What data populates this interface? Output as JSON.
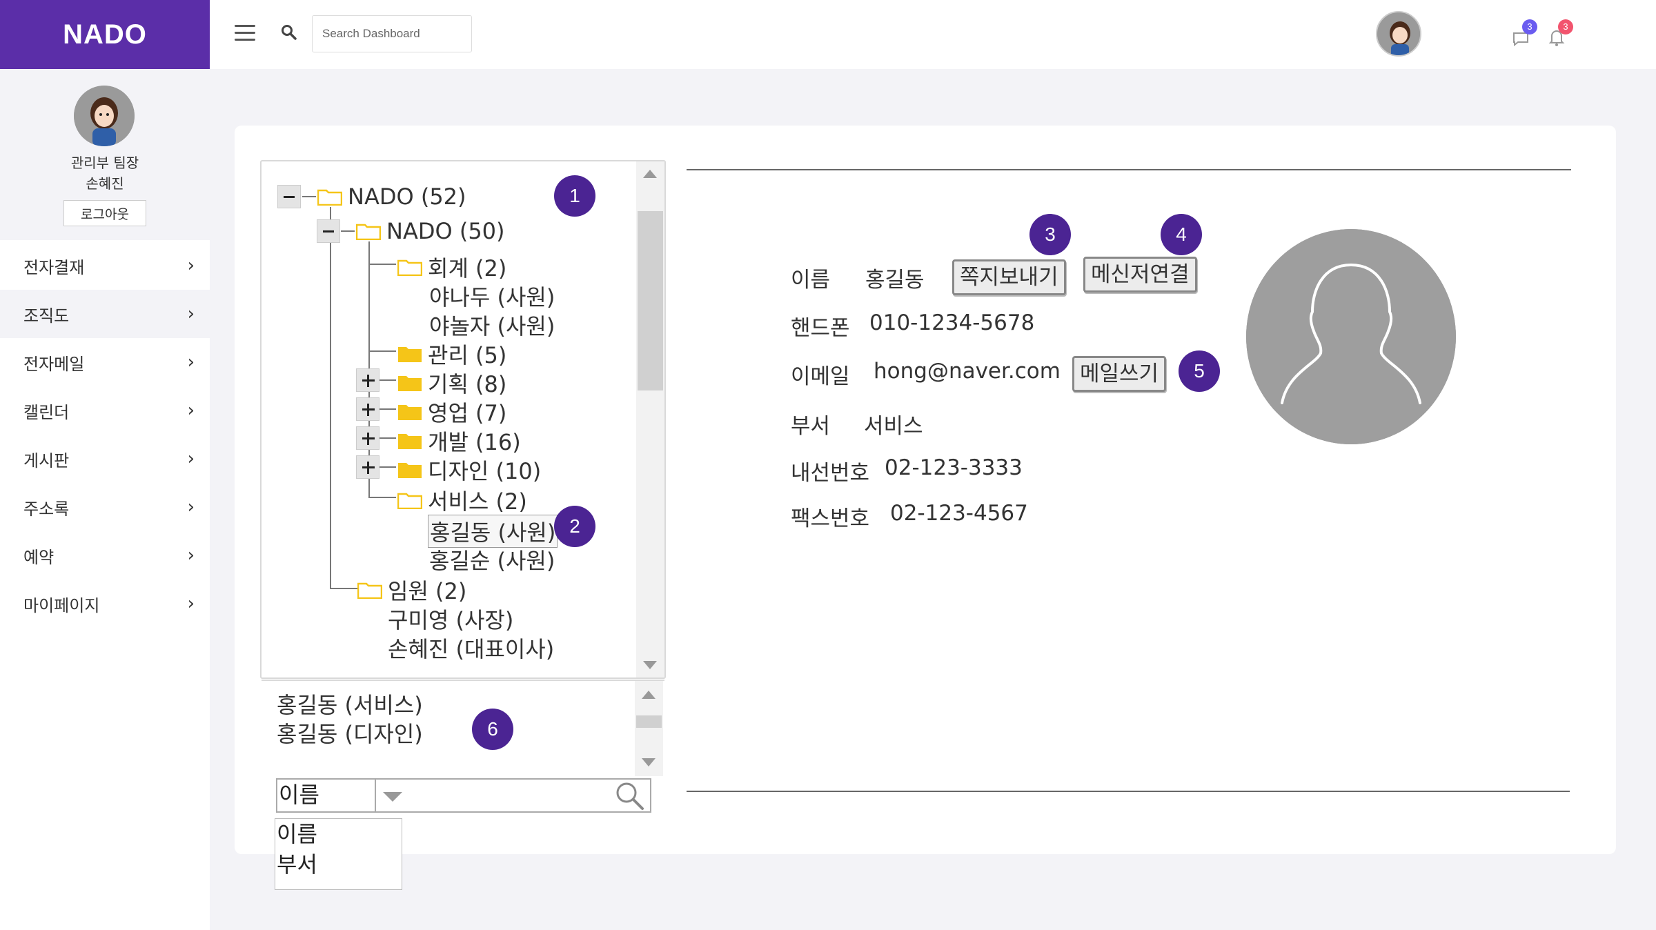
{
  "app": {
    "logo": "NADO"
  },
  "topbar": {
    "search_placeholder": "Search Dashboard",
    "messages_badge": "3",
    "notifications_badge": "3",
    "badge_colors": {
      "messages": "#6a5cf0",
      "notifications": "#f2546e"
    }
  },
  "sidebar": {
    "profile": {
      "role": "관리부 팀장",
      "name": "손혜진",
      "logout": "로그아웃"
    },
    "items": [
      {
        "label": "전자결재"
      },
      {
        "label": "조직도"
      },
      {
        "label": "전자메일"
      },
      {
        "label": "캘린더"
      },
      {
        "label": "게시판"
      },
      {
        "label": "주소록"
      },
      {
        "label": "예약"
      },
      {
        "label": "마이페이지"
      }
    ]
  },
  "tree": {
    "root": "NADO (52)",
    "company": "NADO (50)",
    "departments": {
      "accounting": "회계 (2)",
      "management": "관리 (5)",
      "planning": "기획 (8)",
      "sales": "영업 (7)",
      "development": "개발 (16)",
      "design": "디자인 (10)",
      "service": "서비스 (2)",
      "executives": "임원 (2)"
    },
    "members": {
      "accounting_1": "야나두 (사원)",
      "accounting_2": "야놀자 (사원)",
      "service_1": "홍길동 (사원)",
      "service_2": "홍길순 (사원)",
      "exec_1": "구미영 (사장)",
      "exec_2": "손혜진 (대표이사)"
    }
  },
  "search_results": [
    "홍길동 (서비스)",
    "홍길동 (디자인)"
  ],
  "search": {
    "selected": "이름",
    "options": [
      "이름",
      "부서"
    ]
  },
  "detail": {
    "name_label": "이름",
    "name_value": "홍길동",
    "phone_label": "핸드폰",
    "phone_value": "010-1234-5678",
    "email_label": "이메일",
    "email_value": "hong@naver.com",
    "dept_label": "부서",
    "dept_value": "서비스",
    "ext_label": "내선번호",
    "ext_value": "02-123-3333",
    "fax_label": "팩스번호",
    "fax_value": "02-123-4567",
    "send_note_button": "쪽지보내기",
    "messenger_button": "메신저연결",
    "send_mail_button": "메일쓰기"
  },
  "annotations": [
    "1",
    "2",
    "3",
    "4",
    "5",
    "6"
  ],
  "colors": {
    "brand": "#5b2ea8",
    "annotation": "#4b2493",
    "folder": "#f5c518"
  }
}
